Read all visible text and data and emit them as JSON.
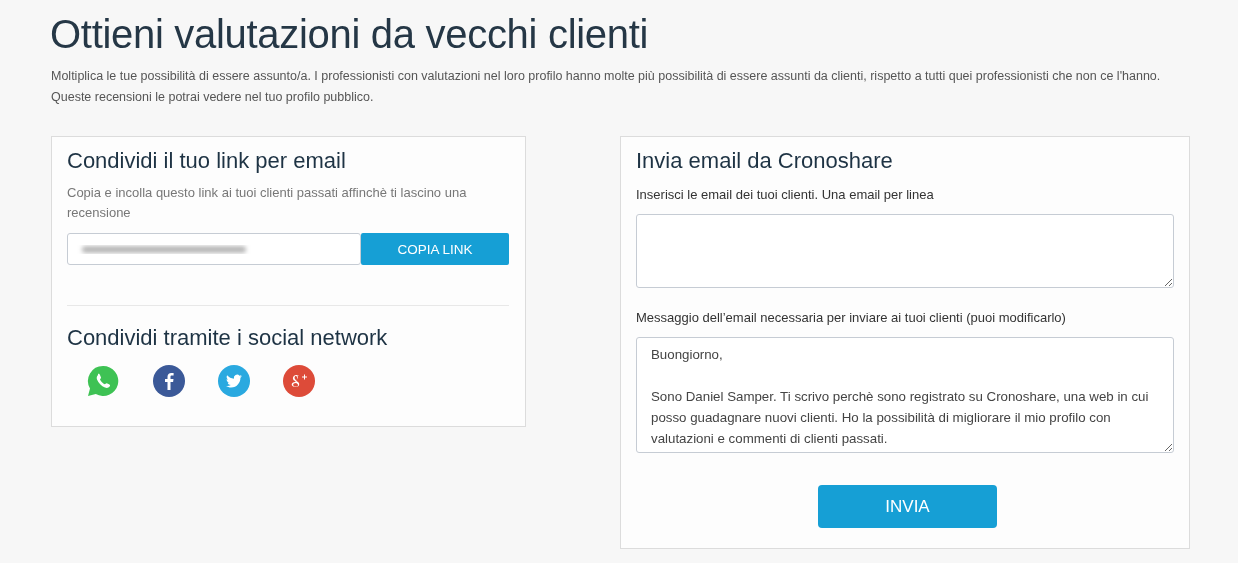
{
  "page": {
    "title": "Ottieni valutazioni da vecchi clienti",
    "intro": "Moltiplica le tue possibilità di essere assunto/a. I professionisti con valutazioni nel loro profilo hanno molte più possibilità di essere assunti da clienti, rispetto a tutti quei professionisti che non ce l'hanno. Queste recensioni le potrai vedere nel tuo profilo pubblico."
  },
  "link_card": {
    "title": "Condividi il tuo link per email",
    "hint": "Copia e incolla questo link ai tuoi clienti passati affinchè ti lascino una recensione",
    "copy_button": "COPIA LINK",
    "social_title": "Condividi tramite i social network"
  },
  "email_card": {
    "title": "Invia email da Cronoshare",
    "emails_label": "Inserisci le email dei tuoi clienti. Una email per linea",
    "message_label": "Messaggio dell’email necessaria per inviare ai tuoi clienti (puoi modificarlo)",
    "message": "Buongiorno,\n\nSono Daniel Samper. Ti scrivo perchè sono registrato su Cronoshare, una web in cui posso guadagnare nuovi clienti. Ho la possibilità di migliorare il mio profilo con valutazioni e commenti di clienti passati.",
    "send_button": "INVIA"
  }
}
